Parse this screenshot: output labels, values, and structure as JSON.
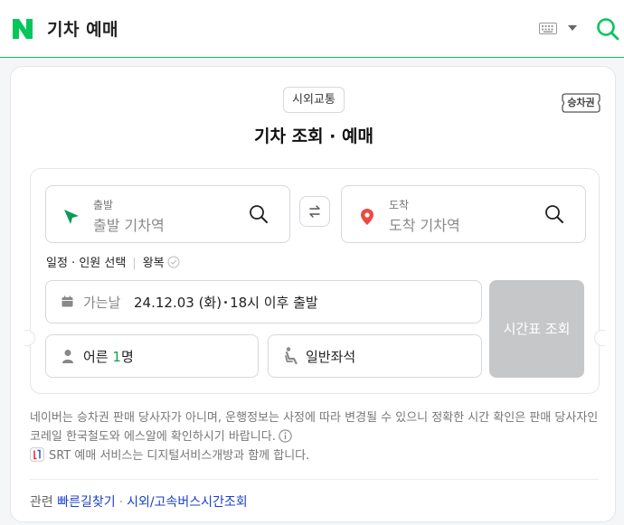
{
  "header": {
    "title": "기차 예매",
    "icons": {
      "logo": "naver-n-logo",
      "keyboard": "keyboard-icon",
      "dropdown": "caret-down-icon",
      "search": "search-icon"
    },
    "colors": {
      "brand": "#03c75a",
      "logo_green": "#03c75a"
    }
  },
  "card": {
    "category": "시외교통",
    "badge": "승차권",
    "title": "기차 조회 · 예매"
  },
  "form": {
    "departure": {
      "label": "출발",
      "placeholder": "출발 기차역",
      "icon": "navigation-arrow-icon",
      "icon_color": "#0a9a55"
    },
    "arrival": {
      "label": "도착",
      "placeholder": "도착 기차역",
      "icon": "location-pin-icon",
      "icon_color": "#f0483e"
    },
    "swap_icon": "swap-arrows-icon",
    "options": {
      "schedule": "일정 · 인원 선택",
      "round_trip": "왕복"
    },
    "date": {
      "label": "가는날",
      "value_date": "24.12.03 (화)",
      "value_time": "18시 이후 출발"
    },
    "people": {
      "prefix": "어른",
      "count": "1",
      "suffix": "명"
    },
    "seat": "일반좌석",
    "submit": "시간표 조회",
    "submit_color": "#c6c7c9"
  },
  "notice": {
    "text": "네이버는 승차권 판매 당사자가 아니며, 운행정보는 사정에 따라 변경될 수 있으니 정확한 시간 확인은 판매 당사자인 코레일 한국철도와 에스알에 확인하시기 바랍니다.",
    "srt": "SRT 예매 서비스는 디지털서비스개방과 함께 합니다."
  },
  "related": {
    "label": "관련",
    "links": [
      "빠른길찾기",
      "시외/고속버스시간조회"
    ]
  }
}
